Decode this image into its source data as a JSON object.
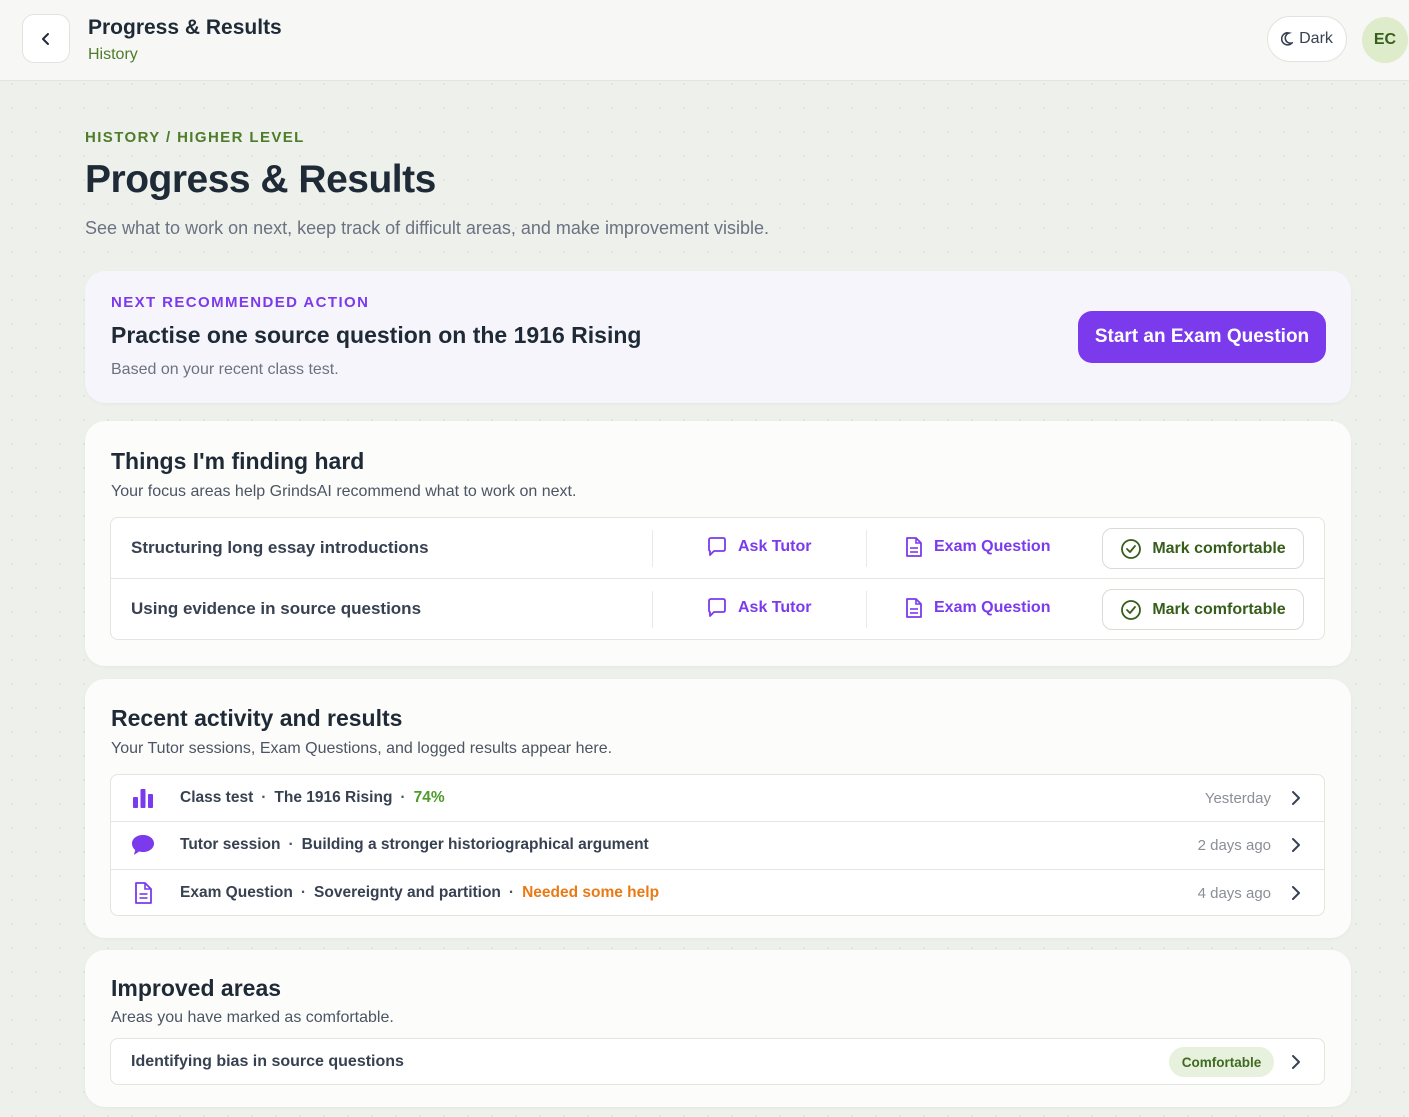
{
  "topbar": {
    "title": "Progress & Results",
    "subtitle": "History",
    "theme_label": "Dark",
    "avatar_initials": "EC"
  },
  "header": {
    "breadcrumb": "HISTORY / HIGHER LEVEL",
    "title": "Progress & Results",
    "description": "See what to work on next, keep track of difficult areas, and make improvement visible."
  },
  "next_action": {
    "label": "NEXT RECOMMENDED ACTION",
    "title": "Practise one source question on the 1916 Rising",
    "note": "Based on your recent class test.",
    "button_label": "Start an Exam Question"
  },
  "hard_things": {
    "title": "Things I'm finding hard",
    "description": "Your focus areas help GrindsAI recommend what to work on next.",
    "items": [
      {
        "label": "Structuring long essay introductions",
        "ask_tutor": "Ask Tutor",
        "exam_question": "Exam Question",
        "mark": "Mark comfortable"
      },
      {
        "label": "Using evidence in source questions",
        "ask_tutor": "Ask Tutor",
        "exam_question": "Exam Question",
        "mark": "Mark comfortable"
      }
    ]
  },
  "recent": {
    "title": "Recent activity and results",
    "description": "Your Tutor sessions, Exam Questions, and logged results appear here.",
    "items": [
      {
        "icon": "bar-chart-icon",
        "type": "Class test",
        "topic": "The 1916 Rising",
        "result": "74%",
        "time": "Yesterday"
      },
      {
        "icon": "chat-bubble-icon",
        "type": "Tutor session",
        "topic": "Building a stronger historiographical argument",
        "result": "",
        "time": "2 days ago"
      },
      {
        "icon": "document-icon",
        "type": "Exam Question",
        "topic": "Sovereignty and partition",
        "result": "Needed some help",
        "time": "4 days ago"
      }
    ]
  },
  "improved": {
    "title": "Improved areas",
    "description": "Areas you have marked as comfortable.",
    "items": [
      {
        "label": "Identifying bias in source questions",
        "badge": "Comfortable"
      }
    ]
  },
  "colors": {
    "accent_purple": "#7c3aed",
    "accent_green": "#4d7c2a",
    "result_good": "#4d9b2a",
    "result_warning": "#ea7a13",
    "badge_bg": "#e7f1dd"
  }
}
